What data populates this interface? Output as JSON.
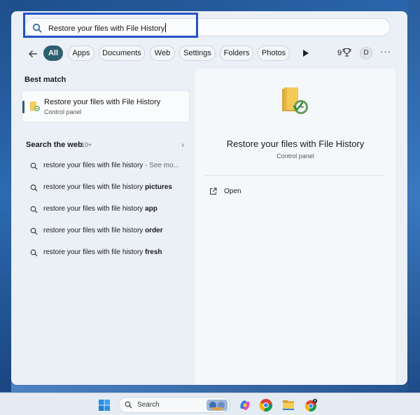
{
  "search": {
    "query": "Restore your files with File History",
    "icon": "search-icon"
  },
  "filters": {
    "back_icon": "back-arrow-icon",
    "chips": [
      "All",
      "Apps",
      "Documents",
      "Web",
      "Settings",
      "Folders",
      "Photos"
    ],
    "active_chip": "All",
    "points_count": "9",
    "avatar_initial": "D",
    "more_label": "···"
  },
  "best_match": {
    "section_title": "Best match",
    "title": "Restore your files with File History",
    "subtitle": "Control panel"
  },
  "web": {
    "section_title": "Search the web",
    "count": "10+",
    "items": [
      {
        "text": "restore your files with file history",
        "bold": "",
        "suffix": " - See mo..."
      },
      {
        "text": "restore your files with file history ",
        "bold": "pictures",
        "suffix": ""
      },
      {
        "text": "restore your files with file history ",
        "bold": "app",
        "suffix": ""
      },
      {
        "text": "restore your files with file history ",
        "bold": "order",
        "suffix": ""
      },
      {
        "text": "restore your files with file history ",
        "bold": "fresh",
        "suffix": ""
      }
    ]
  },
  "detail": {
    "title": "Restore your files with File History",
    "subtitle": "Control panel",
    "action_open": "Open"
  },
  "taskbar": {
    "search_label": "Search",
    "apps": [
      "copilot-icon",
      "chrome-icon",
      "file-explorer-icon",
      "chrome-canary-icon"
    ]
  },
  "colors": {
    "accent": "#2d5f6e",
    "highlight_box": "#2352c8"
  }
}
